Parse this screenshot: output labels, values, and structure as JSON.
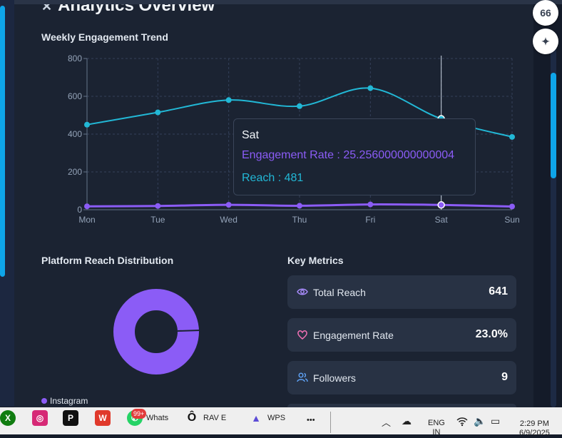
{
  "card": {
    "title": "Analytics Overview",
    "title_icon": "sparkle-icon"
  },
  "sections": {
    "weekly": "Weekly Engagement Trend",
    "platform": "Platform Reach Distribution",
    "metrics": "Key Metrics"
  },
  "chart_data": {
    "type": "line",
    "categories": [
      "Mon",
      "Tue",
      "Wed",
      "Thu",
      "Fri",
      "Sat",
      "Sun"
    ],
    "series": [
      {
        "name": "Reach",
        "color": "#22b8d6",
        "values": [
          450,
          515,
          580,
          548,
          643,
          481,
          385
        ]
      },
      {
        "name": "Engagement Rate",
        "color": "#8b5cf6",
        "values": [
          18,
          20,
          26,
          21,
          28,
          25.256,
          17
        ]
      }
    ],
    "ylim": [
      0,
      800
    ],
    "yticks": [
      "0",
      "200",
      "400",
      "600",
      "800"
    ],
    "grid": true,
    "active_category": "Sat"
  },
  "tooltip": {
    "day": "Sat",
    "engagement": "Engagement Rate : 25.256000000000004",
    "reach": "Reach : 481"
  },
  "donut": {
    "legend": "Instagram",
    "color": "#8b5cf6",
    "value_fraction": 0.99
  },
  "metrics": [
    {
      "label": "Total Reach",
      "value": "641",
      "icon": "eye-icon"
    },
    {
      "label": "Engagement Rate",
      "value": "23.0%",
      "icon": "heart-icon"
    },
    {
      "label": "Followers",
      "value": "9",
      "icon": "users-icon"
    }
  ],
  "float_buttons": {
    "top_icon": "quote-icon",
    "bottom_icon": "sparkle-icon",
    "top_glyph": "66"
  },
  "taskbar": {
    "apps": [
      {
        "name": "xbox-icon",
        "glyph": "X",
        "label": ""
      },
      {
        "name": "instagram-icon",
        "glyph": "◎",
        "label": ""
      },
      {
        "name": "p-app-icon",
        "glyph": "P",
        "label": ""
      },
      {
        "name": "wps-office-icon",
        "glyph": "W",
        "label": ""
      },
      {
        "name": "whatsapp-icon",
        "glyph": "✆",
        "label": "Whats"
      },
      {
        "name": "rav-icon",
        "glyph": "Ô",
        "label": "RAV E"
      },
      {
        "name": "wps-icon",
        "glyph": "▲",
        "label": "WPS"
      }
    ],
    "badge": "99+",
    "more": "•••",
    "lang_top": "ENG",
    "lang_bottom": "IN",
    "time": "2:29 PM",
    "date": "6/9/2025"
  }
}
